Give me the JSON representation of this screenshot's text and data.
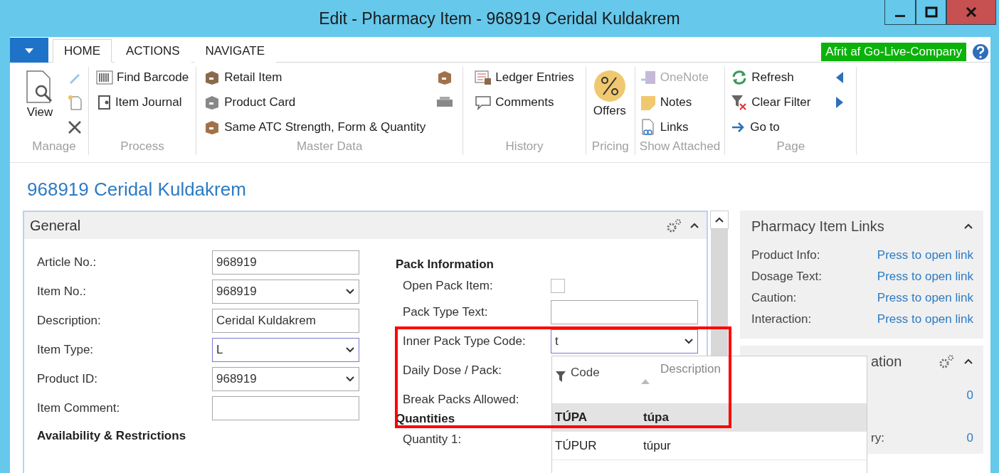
{
  "window": {
    "title": "Edit - Pharmacy Item - 968919 Ceridal Kuldakrem"
  },
  "ribbon": {
    "tabs": [
      {
        "label": "HOME",
        "selected": true
      },
      {
        "label": "ACTIONS",
        "selected": false
      },
      {
        "label": "NAVIGATE",
        "selected": false
      }
    ],
    "company": "Afrit af Go-Live-Company",
    "groups": [
      {
        "label": "Manage",
        "actions": [
          {
            "label": "View",
            "disabled": false
          }
        ]
      },
      {
        "label": "Process",
        "actions": [
          {
            "label": "Find Barcode",
            "disabled": false
          },
          {
            "label": "Item Journal",
            "disabled": false
          }
        ]
      },
      {
        "label": "Master Data",
        "actions": [
          {
            "label": "Retail Item",
            "disabled": false
          },
          {
            "label": "Product Card",
            "disabled": false
          },
          {
            "label": "Same ATC Strength, Form & Quantity",
            "disabled": false
          }
        ]
      },
      {
        "label": "History",
        "actions": [
          {
            "label": "Ledger Entries",
            "disabled": false
          },
          {
            "label": "Comments",
            "disabled": false
          }
        ]
      },
      {
        "label": "Pricing",
        "actions": [
          {
            "label": "Offers",
            "disabled": false
          }
        ]
      },
      {
        "label": "Show Attached",
        "actions": [
          {
            "label": "OneNote",
            "disabled": true
          },
          {
            "label": "Notes",
            "disabled": false
          },
          {
            "label": "Links",
            "disabled": false
          }
        ]
      },
      {
        "label": "Page",
        "actions": [
          {
            "label": "Refresh",
            "disabled": false
          },
          {
            "label": "Clear Filter",
            "disabled": false
          },
          {
            "label": "Go to",
            "disabled": false
          }
        ]
      }
    ]
  },
  "page_title": "968919 Ceridal Kuldakrem",
  "general": {
    "title": "General",
    "fields": [
      {
        "label": "Article No.:",
        "kind": "text",
        "value": "968919"
      },
      {
        "label": "Item No.:",
        "kind": "dropdown",
        "value": "968919"
      },
      {
        "label": "Description:",
        "kind": "text",
        "value": "Ceridal Kuldakrem"
      },
      {
        "label": "Item Type:",
        "kind": "dropdown",
        "value": "L"
      },
      {
        "label": "Product ID:",
        "kind": "dropdown",
        "value": "968919"
      },
      {
        "label": "Item Comment:",
        "kind": "text"
      }
    ],
    "availability_heading": "Availability & Restrictions",
    "pack_heading": "Pack Information",
    "pack_fields": [
      {
        "label": "Open Pack Item:",
        "kind": "checkbox",
        "checked": false
      },
      {
        "label": "Pack Type Text:",
        "kind": "text"
      },
      {
        "label": "Inner Pack Type Code:",
        "kind": "dropdown",
        "value": "t"
      },
      {
        "label": "Daily Dose / Pack:",
        "kind": "covered"
      },
      {
        "label": "Break Packs Allowed:",
        "kind": "covered"
      }
    ],
    "quantities_heading": "Quantities",
    "quantity_fields": [
      {
        "label": "Quantity 1:"
      }
    ]
  },
  "lookup": {
    "columns": [
      {
        "label": "Code"
      },
      {
        "label": "Description"
      }
    ],
    "rows": [
      {
        "code": "TÚPA",
        "description": "túpa",
        "selected": true
      },
      {
        "code": "TÚPUR",
        "description": "túpur",
        "selected": false
      }
    ]
  },
  "factboxes": [
    {
      "title": "Pharmacy Item Links",
      "rows": [
        {
          "label": "Product Info:",
          "value": "Press to open link"
        },
        {
          "label": "Dosage Text:",
          "value": "Press to open link"
        },
        {
          "label": "Caution:",
          "value": "Press to open link"
        },
        {
          "label": "Interaction:",
          "value": "Press to open link"
        }
      ]
    },
    {
      "title": "ation",
      "rows": [
        {
          "value": "0"
        },
        {
          "label": "ry:",
          "value": "0"
        }
      ]
    }
  ]
}
